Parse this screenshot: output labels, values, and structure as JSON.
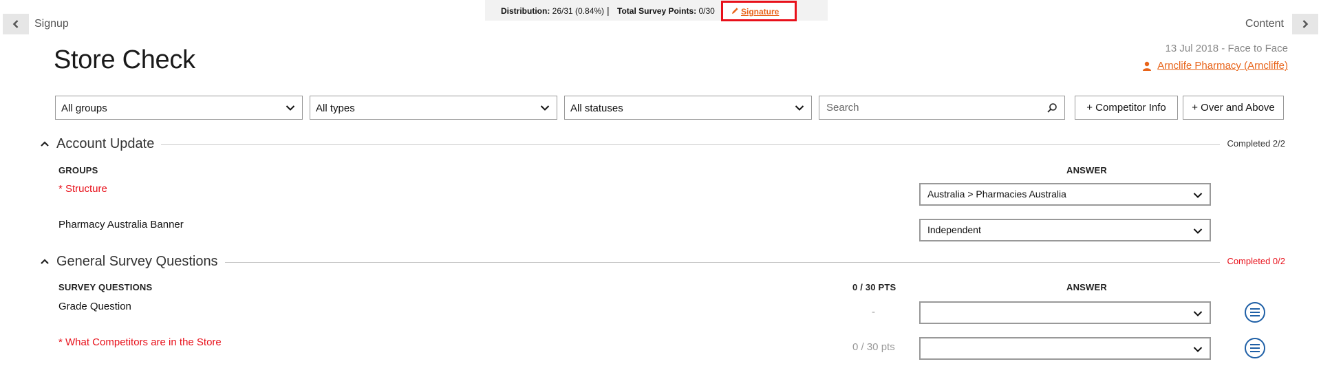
{
  "topbar": {
    "distribution_label": "Distribution:",
    "distribution_value": "26/31 (0.84%)",
    "separator": "|",
    "points_label": "Total Survey Points:",
    "points_value": "0/30",
    "signature_label": "Signature"
  },
  "nav": {
    "prev_label": "Signup",
    "next_label": "Content"
  },
  "page": {
    "title": "Store Check",
    "date_line": "13 Jul 2018  -  Face to Face",
    "store_name": "Arnclife Pharmacy (Arncliffe)"
  },
  "filters": {
    "groups": "All groups",
    "types": "All types",
    "statuses": "All statuses",
    "search_placeholder": "Search",
    "competitor_button": "+ Competitor Info",
    "over_above_button": "+ Over and Above"
  },
  "sections": [
    {
      "title": "Account Update",
      "completed": "Completed 2/2",
      "completed_color": "#333333",
      "col_left": "GROUPS",
      "col_answer": "ANSWER",
      "rows": [
        {
          "question": "* Structure",
          "required": true,
          "answer": "Australia > Pharmacies Australia"
        },
        {
          "question": "Pharmacy Australia Banner",
          "required": false,
          "answer": "Independent"
        }
      ]
    },
    {
      "title": "General Survey Questions",
      "completed": "Completed 0/2",
      "completed_color": "#e8101a",
      "col_left": "SURVEY QUESTIONS",
      "col_points": "0 / 30 PTS",
      "col_answer": "ANSWER",
      "rows": [
        {
          "question": "Grade Question",
          "required": false,
          "points": "-",
          "answer": ""
        },
        {
          "question": "* What Competitors are in the Store",
          "required": true,
          "points": "0 / 30 pts",
          "answer": ""
        }
      ]
    }
  ],
  "colors": {
    "accent": "#e8641a",
    "required": "#e8101a",
    "icon_blue": "#1e5fa6"
  },
  "icons": {
    "prev": "chevron-left-icon",
    "next": "chevron-right-icon",
    "pen": "pencil-icon",
    "person": "person-icon",
    "search": "search-icon",
    "dropdown": "chevron-down-icon",
    "collapse": "chevron-up-icon",
    "menu": "list-menu-icon"
  }
}
